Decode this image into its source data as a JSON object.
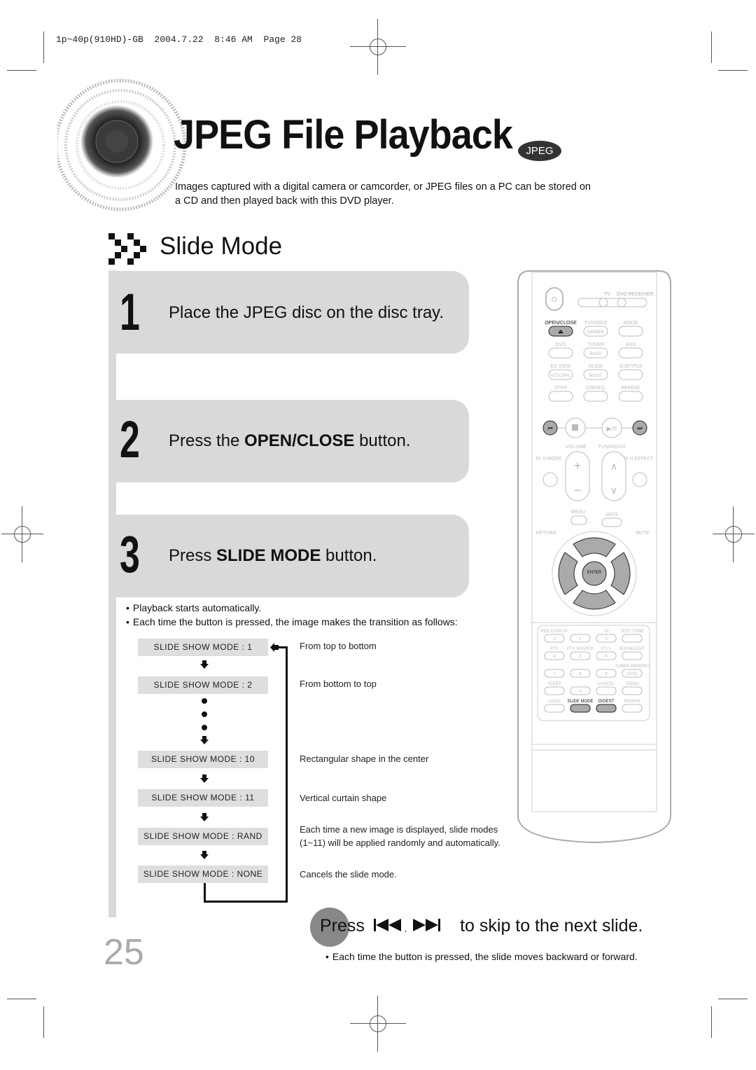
{
  "print_slug": "1p~40p(910HD)-GB  2004.7.22  8:46 AM  Page 28",
  "header": {
    "title": "JPEG File Playback",
    "badge": "JPEG",
    "intro": "Images captured with a digital camera or camcorder, or JPEG files on a PC can be stored on a CD and then played back with this DVD player."
  },
  "section": {
    "title": "Slide Mode"
  },
  "steps": [
    {
      "number": "1",
      "text_before": "Place the JPEG disc on the disc tray.",
      "bold": "",
      "text_after": ""
    },
    {
      "number": "2",
      "text_before": "Press the ",
      "bold": "OPEN/CLOSE",
      "text_after": " button."
    },
    {
      "number": "3",
      "text_before": "Press ",
      "bold": "SLIDE MODE",
      "text_after": " button."
    }
  ],
  "notes": [
    "Playback starts automatically.",
    "Each time the button is pressed, the image makes the transition as follows:"
  ],
  "slide_modes": [
    {
      "label": "SLIDE SHOW MODE : 1",
      "description": "From top to bottom"
    },
    {
      "label": "SLIDE SHOW MODE : 2",
      "description": "From bottom to top"
    },
    {
      "label": "SLIDE SHOW MODE : 10",
      "description": "Rectangular shape in the center"
    },
    {
      "label": "SLIDE SHOW MODE : 11",
      "description": "Vertical curtain shape"
    },
    {
      "label": "SLIDE SHOW MODE : RAND",
      "description": "Each time a new image is displayed, slide modes (1~11) will be applied randomly and automatically."
    },
    {
      "label": "SLIDE SHOW MODE : NONE",
      "description": "Cancels the slide mode."
    }
  ],
  "skip_tip": {
    "press": "Press",
    "separator": ",",
    "text": "to skip to the next slide.",
    "note": "Each time the button is pressed, the slide moves backward or forward."
  },
  "page_number": "25",
  "remote": {
    "top_labels": {
      "tv": "TV",
      "dvd_receiver": "DVD RECEIVER"
    },
    "rows": [
      [
        "OPEN/CLOSE",
        "TV/VIDEO",
        "MODE"
      ],
      [
        "DVD",
        "TUNER",
        "AUX"
      ],
      [
        "EZ VIEW",
        "SLOW",
        "SUBTITLE"
      ],
      [
        "STEP",
        "DSP/EQ",
        "REPEAT"
      ]
    ],
    "button_faces": {
      "dimmer": "DIMMER",
      "band": "BAND",
      "ntsc_pal": "NTSC/PAL",
      "mo_st": "MO/ST"
    },
    "mid_labels": {
      "volume": "VOLUME",
      "tuning": "TUNING/CH",
      "pl2_mode": "PL II MODE",
      "pl2_effect": "PL II EFFECT",
      "menu": "MENU",
      "info": "INFO",
      "return": "RETURN",
      "mute": "MUTE",
      "enter": "ENTER"
    },
    "keypad_labels": [
      "RDS DISPLAY",
      "",
      "TA",
      "TEST TONE",
      "PTY-",
      "PTY SEARCH",
      "PTY+",
      "SOUND EDIT",
      "",
      "",
      "",
      "TUNER MEMORY",
      "SLEEP",
      "",
      "CANCEL",
      "ZOOM",
      "LOGO",
      "SLIDE MODE",
      "DIGEST",
      "REMAIN"
    ],
    "keypad_faces": [
      "1",
      "2",
      "3",
      "",
      "4",
      "5",
      "6",
      "",
      "7",
      "8",
      "9",
      "DCDi",
      "",
      "0",
      "",
      "",
      "",
      "",
      "",
      ""
    ],
    "highlight_color": "#aaaaaa"
  }
}
